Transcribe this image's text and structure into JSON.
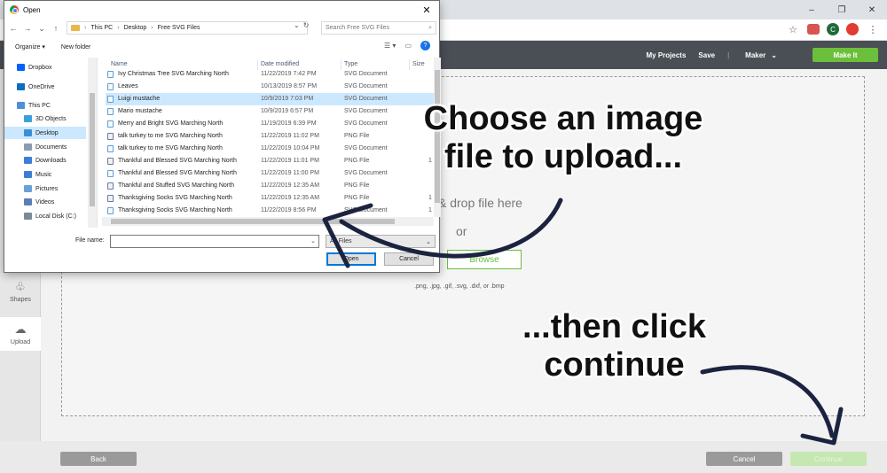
{
  "browser": {
    "window_controls": [
      "–",
      "❐",
      "✕"
    ],
    "avatar_letter": "C"
  },
  "app": {
    "nav": {
      "my_projects": "My Projects",
      "save": "Save",
      "separator": "|",
      "maker": "Maker",
      "make_it": "Make It"
    },
    "rail": [
      {
        "label": "Shapes"
      },
      {
        "label": "Upload"
      }
    ],
    "upload": {
      "drop_text": "& drop file here",
      "or_text": "or",
      "browse_label": "Browse",
      "formats": ".png, .jpg, .gif, .svg, .dxf, or .bmp"
    },
    "footer": {
      "back": "Back",
      "cancel": "Cancel",
      "continue": "Continue"
    }
  },
  "dialog": {
    "title": "Open",
    "breadcrumb": [
      "This PC",
      "Desktop",
      "Free SVG Files"
    ],
    "search_placeholder": "Search Free SVG Files",
    "organize": "Organize ▾",
    "new_folder": "New folder",
    "nav_items": [
      {
        "label": "Dropbox",
        "color": "#0061fe"
      },
      {
        "label": "OneDrive",
        "color": "#0f6cbd"
      },
      {
        "label": "This PC",
        "color": "#4f8fd6"
      },
      {
        "label": "3D Objects",
        "color": "#36a2d9"
      },
      {
        "label": "Desktop",
        "color": "#3b8fd8"
      },
      {
        "label": "Documents",
        "color": "#8a9bb0"
      },
      {
        "label": "Downloads",
        "color": "#3b7fd8"
      },
      {
        "label": "Music",
        "color": "#3b7fd8"
      },
      {
        "label": "Pictures",
        "color": "#6aa0d8"
      },
      {
        "label": "Videos",
        "color": "#5a7fb8"
      },
      {
        "label": "Local Disk (C:)",
        "color": "#7a8a99"
      }
    ],
    "columns": {
      "name": "Name",
      "date": "Date modified",
      "type": "Type",
      "size": "Size"
    },
    "files": [
      {
        "name": "Ivy Christmas Tree SVG Marching North",
        "date": "11/22/2019 7:42 PM",
        "type": "SVG Document",
        "size": "",
        "kind": "svg"
      },
      {
        "name": "Leaves",
        "date": "10/13/2019 8:57 PM",
        "type": "SVG Document",
        "size": "",
        "kind": "svg"
      },
      {
        "name": "Luigi mustache",
        "date": "10/9/2019 7:03 PM",
        "type": "SVG Document",
        "size": "",
        "kind": "svg"
      },
      {
        "name": "Mario mustache",
        "date": "10/9/2019 6:57 PM",
        "type": "SVG Document",
        "size": "",
        "kind": "svg"
      },
      {
        "name": "Merry and Bright SVG Marching North",
        "date": "11/19/2019 6:39 PM",
        "type": "SVG Document",
        "size": "",
        "kind": "svg"
      },
      {
        "name": "talk turkey to me SVG Marching North",
        "date": "11/22/2019 11:02 PM",
        "type": "PNG File",
        "size": "",
        "kind": "png"
      },
      {
        "name": "talk turkey to me SVG Marching North",
        "date": "11/22/2019 10:04 PM",
        "type": "SVG Document",
        "size": "",
        "kind": "svg"
      },
      {
        "name": "Thankful and Blessed SVG Marching North",
        "date": "11/22/2019 11:01 PM",
        "type": "PNG File",
        "size": "1",
        "kind": "png"
      },
      {
        "name": "Thankful and Blessed SVG Marching North",
        "date": "11/22/2019 11:00 PM",
        "type": "SVG Document",
        "size": "",
        "kind": "svg"
      },
      {
        "name": "Thankful and Stuffed SVG Marching North",
        "date": "11/22/2019 12:35 AM",
        "type": "PNG File",
        "size": "",
        "kind": "png"
      },
      {
        "name": "Thanksgiving Socks SVG Marching North",
        "date": "11/22/2019 12:35 AM",
        "type": "PNG File",
        "size": "1",
        "kind": "png"
      },
      {
        "name": "Thanksgiving Socks SVG Marching North",
        "date": "11/22/2019 8:56 PM",
        "type": "SVG Document",
        "size": "1",
        "kind": "svg"
      }
    ],
    "selected_index": 2,
    "file_name_label": "File name:",
    "file_name_value": "",
    "file_type": "All Files",
    "open_label": "Open",
    "cancel_label": "Cancel"
  },
  "annotations": {
    "callout_one": [
      "Choose an image",
      "file to upload..."
    ],
    "callout_two": [
      "...then click",
      "continue"
    ]
  },
  "colors": {
    "accent_green": "#6bbf3a",
    "app_header": "#4a4f55",
    "selection": "#cce8ff",
    "arrow": "#1b2340"
  }
}
